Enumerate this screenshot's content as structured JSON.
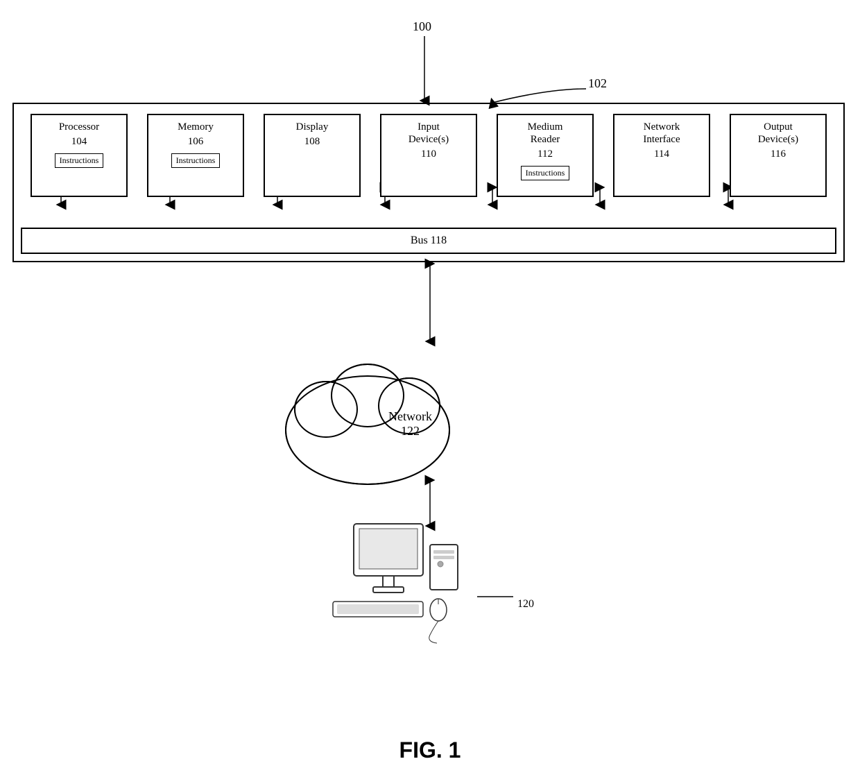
{
  "labels": {
    "main_ref": "100",
    "system_ref": "102",
    "processor_name": "Processor",
    "processor_num": "104",
    "memory_name": "Memory",
    "memory_num": "106",
    "display_name": "Display",
    "display_num": "108",
    "input_devices_name": "Input",
    "input_devices_name2": "Device(s)",
    "input_devices_num": "110",
    "medium_reader_name": "Medium",
    "medium_reader_name2": "Reader",
    "medium_reader_num": "112",
    "network_interface_name": "Network",
    "network_interface_name2": "Interface",
    "network_interface_num": "114",
    "output_devices_name": "Output",
    "output_devices_name2": "Device(s)",
    "output_devices_num": "116",
    "instructions": "Instructions",
    "bus": "Bus 118",
    "network_name": "Network",
    "network_num": "122",
    "computer_ref": "120",
    "fig_caption": "FIG. 1"
  }
}
